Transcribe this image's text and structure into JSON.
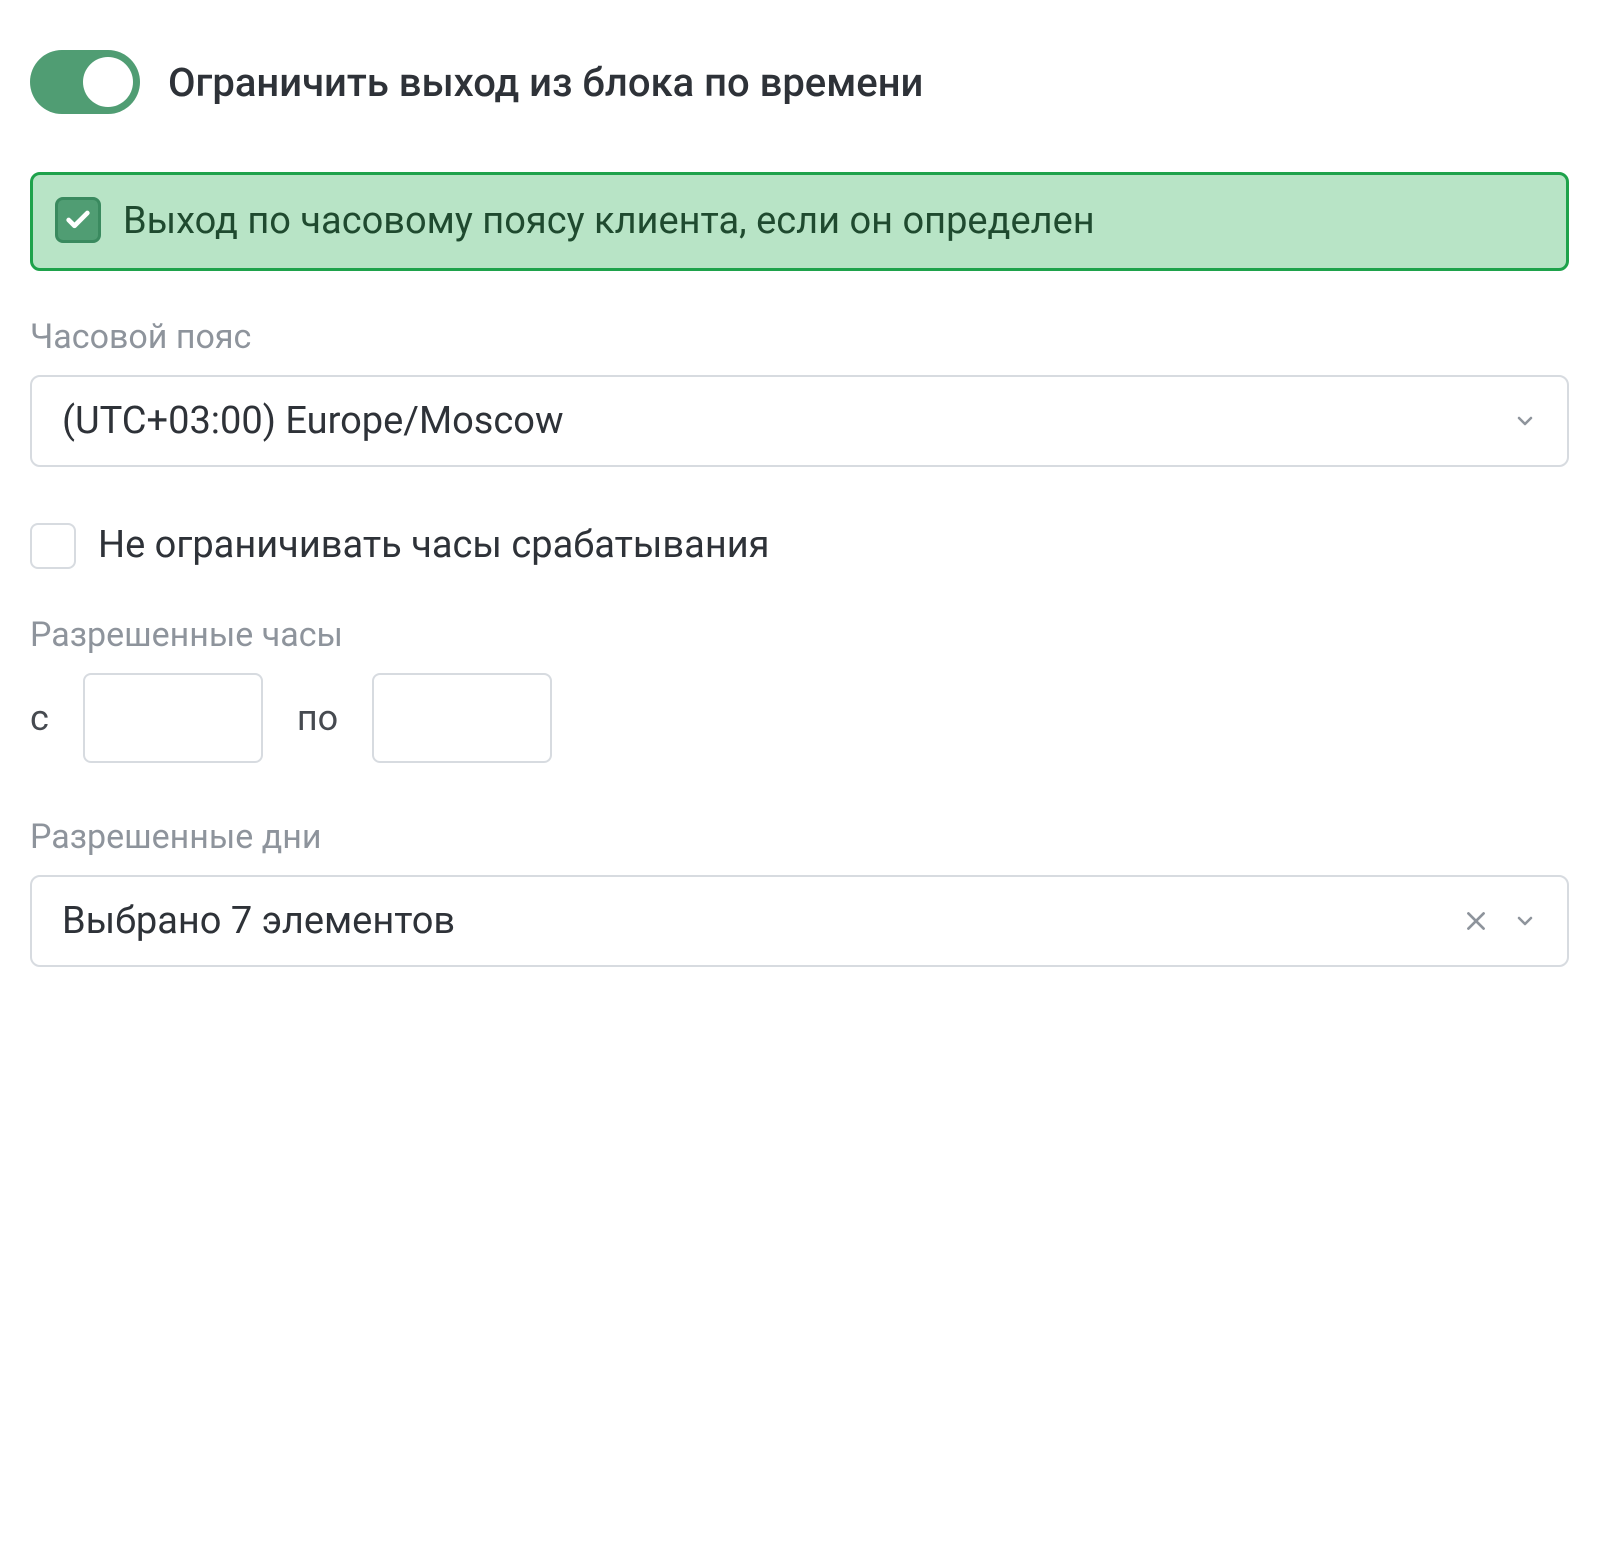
{
  "toggle": {
    "label": "Ограничить выход из блока по времени",
    "on": true
  },
  "client_tz_checkbox": {
    "label": "Выход по часовому поясу клиента, если он определен",
    "checked": true
  },
  "timezone": {
    "label": "Часовой пояс",
    "value": "(UTC+03:00) Europe/Moscow"
  },
  "unrestricted_hours": {
    "label": "Не ограничивать часы срабатывания",
    "checked": false
  },
  "allowed_hours": {
    "label": "Разрешенные часы",
    "from_label": "с",
    "to_label": "по",
    "from_value": "",
    "to_value": ""
  },
  "allowed_days": {
    "label": "Разрешенные дни",
    "value": "Выбрано 7 элементов"
  }
}
